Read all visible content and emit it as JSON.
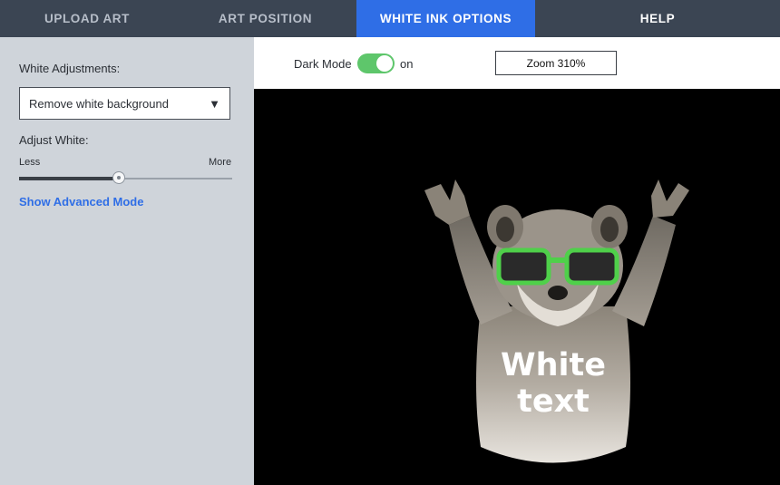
{
  "nav": {
    "tabs": [
      {
        "label": "UPLOAD ART",
        "active": false
      },
      {
        "label": "ART POSITION",
        "active": false
      },
      {
        "label": "WHITE INK OPTIONS",
        "active": true
      },
      {
        "label": "HELP",
        "active": false
      }
    ],
    "active_color": "#2f6ee6",
    "bar_color": "#3b4553"
  },
  "sidebar": {
    "white_adjustments_label": "White Adjustments:",
    "select": {
      "value": "Remove white background",
      "caret": "▼"
    },
    "adjust_white_label": "Adjust White:",
    "slider": {
      "min_label": "Less",
      "max_label": "More",
      "value_fraction": 0.47
    },
    "advanced_link": "Show Advanced Mode",
    "link_color": "#2f6ee6"
  },
  "toolbar": {
    "dark_mode_label": "Dark Mode",
    "dark_mode_on": true,
    "toggle_color": "#5ec66b",
    "state_label": "on",
    "zoom_label": "Zoom 310%"
  },
  "canvas": {
    "background": "#000000",
    "art": {
      "subject": "raccoon-with-green-sunglasses",
      "text_line1": "White",
      "text_line2": "text",
      "glasses_color": "#4fd04a"
    }
  }
}
